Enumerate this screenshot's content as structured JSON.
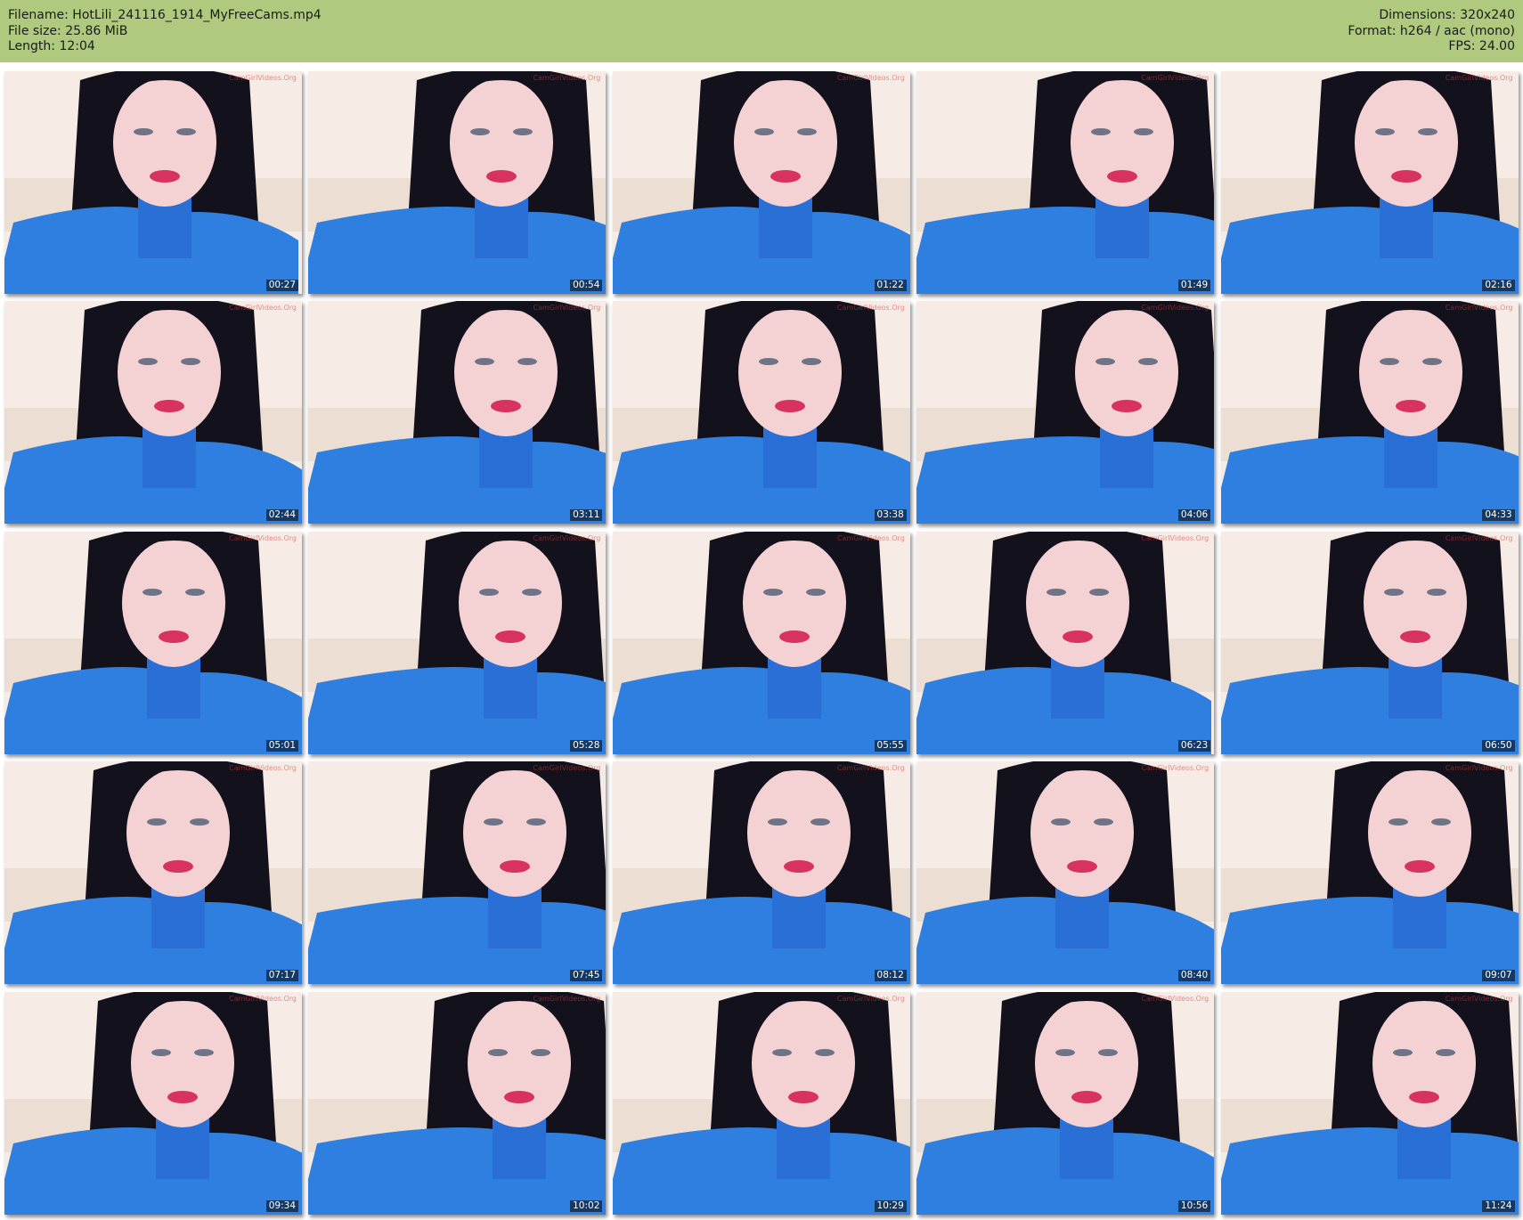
{
  "header": {
    "left": [
      "Filename: HotLili_241116_1914_MyFreeCams.mp4",
      "File size: 25.86 MiB",
      "Length: 12:04"
    ],
    "right": [
      "Dimensions: 320x240",
      "Format: h264 / aac (mono)",
      "FPS: 24.00"
    ],
    "background_color": "#afca7f"
  },
  "thumbnails": [
    {
      "time": "00:27"
    },
    {
      "time": "00:54"
    },
    {
      "time": "01:22"
    },
    {
      "time": "01:49"
    },
    {
      "time": "02:16"
    },
    {
      "time": "02:44"
    },
    {
      "time": "03:11"
    },
    {
      "time": "03:38"
    },
    {
      "time": "04:06"
    },
    {
      "time": "04:33"
    },
    {
      "time": "05:01"
    },
    {
      "time": "05:28"
    },
    {
      "time": "05:55"
    },
    {
      "time": "06:23"
    },
    {
      "time": "06:50"
    },
    {
      "time": "07:17"
    },
    {
      "time": "07:45"
    },
    {
      "time": "08:12"
    },
    {
      "time": "08:40"
    },
    {
      "time": "09:07"
    },
    {
      "time": "09:34"
    },
    {
      "time": "10:02"
    },
    {
      "time": "10:29"
    },
    {
      "time": "10:56"
    },
    {
      "time": "11:24"
    }
  ],
  "watermark": "CamGirlVideos.Org",
  "colors": {
    "sweater": "#2f7fe0",
    "hair": "#12111c",
    "skin": "#f4d2d4",
    "lips": "#d8325f",
    "wall": "#f6ebe5"
  }
}
